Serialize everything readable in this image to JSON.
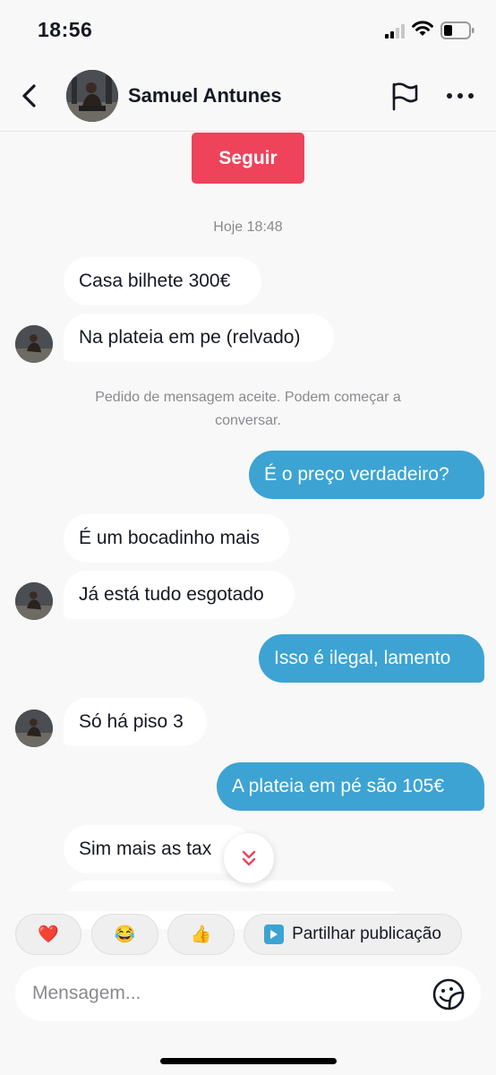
{
  "status_bar": {
    "time": "18:56"
  },
  "header": {
    "name": "Samuel Antunes"
  },
  "follow_button": {
    "label": "Seguir"
  },
  "conversation": {
    "timestamp": "Hoje 18:48",
    "system_note": "Pedido de mensagem aceite. Podem começar a conversar.",
    "messages": [
      {
        "direction": "in",
        "text": "Casa bilhete 300€"
      },
      {
        "direction": "in",
        "text": "Na plateia em pe (relvado)"
      },
      {
        "direction": "out",
        "text": "É o preço verdadeiro?"
      },
      {
        "direction": "in",
        "text": "É um bocadinho mais"
      },
      {
        "direction": "in",
        "text": "Já está tudo esgotado"
      },
      {
        "direction": "out",
        "text": "Isso é ilegal, lamento"
      },
      {
        "direction": "in",
        "text": "Só há piso 3"
      },
      {
        "direction": "out",
        "text": "A plateia em pé são 105€"
      },
      {
        "direction": "in",
        "text": "Sim mais as tax"
      }
    ]
  },
  "quick_reactions": {
    "emojis": [
      "❤️",
      "😂",
      "👍"
    ],
    "share_label": "Partilhar publicação"
  },
  "composer": {
    "placeholder": "Mensagem..."
  },
  "icons": {
    "back": "back-chevron-icon",
    "flag": "flag-icon",
    "more": "more-horizontal-icon",
    "scroll_down": "double-chevron-down-icon",
    "sticker": "sticker-smile-icon"
  },
  "colors": {
    "accent_red": "#ee435a",
    "outgoing_bubble": "#3da3d3"
  }
}
